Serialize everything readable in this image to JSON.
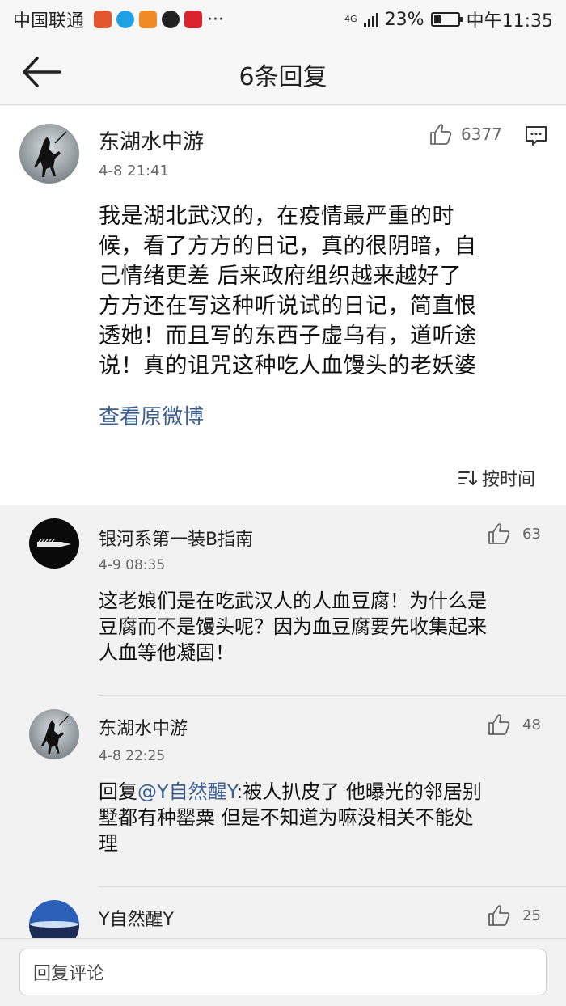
{
  "status_bar": {
    "carrier": "中国联通",
    "more": "···",
    "network": "4G",
    "battery": "23%",
    "time": "中午11:35"
  },
  "nav": {
    "title": "6条回复"
  },
  "post": {
    "author": "东湖水中游",
    "time": "4-8 21:41",
    "likes": "6377",
    "lines": [
      "我是湖北武汉的，在疫情最严重的时",
      "候，看了方方的日记，真的很阴暗，自",
      "己情绪更差 后来政府组织越来越好了",
      "方方还在写这种听说试的日记，简直恨",
      "透她！而且写的东西子虚乌有，道听途",
      "说！真的诅咒这种吃人血馒头的老妖婆"
    ],
    "view_original": "查看原微博",
    "sort_label": "按时间"
  },
  "comments": [
    {
      "author": "银河系第一装B指南",
      "time": "4-9 08:35",
      "likes": "63",
      "lines": [
        "这老娘们是在吃武汉人的人血豆腐！为什么是",
        "豆腐而不是馒头呢？因为血豆腐要先收集起来",
        "人血等他凝固！"
      ]
    },
    {
      "author": "东湖水中游",
      "time": "4-8 22:25",
      "likes": "48",
      "reply_prefix": "回复",
      "mention": "@Y自然醒Y",
      "line1_rest": ":被人扒皮了 他曝光的邻居别",
      "lines": [
        "墅都有种罂粟 但是不知道为嘛没相关不能处",
        "理"
      ]
    },
    {
      "author": "Y自然醒Y",
      "likes": "25"
    }
  ],
  "bottom": {
    "placeholder": "回复评论"
  }
}
